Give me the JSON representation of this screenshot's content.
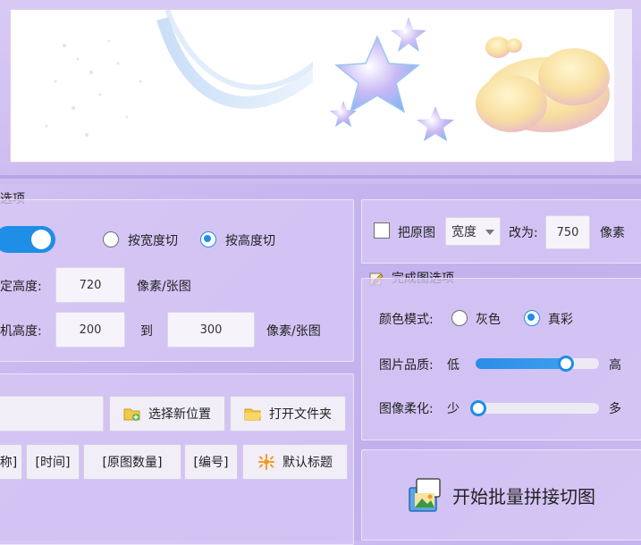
{
  "cut_options": {
    "section_title": "选项",
    "mode_width_label": "按宽度切",
    "mode_height_label": "按高度切",
    "fixed_height_label": "定高度:",
    "fixed_height_value": "720",
    "fixed_height_unit": "像素/张图",
    "random_height_label": "机高度:",
    "random_min_value": "200",
    "random_to_label": "到",
    "random_max_value": "300",
    "random_height_unit": "像素/张图"
  },
  "output": {
    "select_location_label": "选择新位置",
    "open_folder_label": "打开文件夹",
    "tags": [
      "称]",
      "[时间]",
      "[原图数量]",
      "[编号]"
    ],
    "default_title_label": "默认标题"
  },
  "resize": {
    "checkbox_label": "把原图",
    "dimension_value": "宽度",
    "change_to_label": "改为:",
    "value": "750",
    "unit": "像素"
  },
  "finished": {
    "section_title": "完成图选项",
    "color_mode_label": "颜色模式:",
    "gray_label": "灰色",
    "truecolor_label": "真彩",
    "quality_label": "图片品质:",
    "quality_low": "低",
    "quality_high": "高",
    "quality_level_percent": 73,
    "soften_label": "图像柔化:",
    "soften_low": "少",
    "soften_high": "多",
    "soften_level_percent": 0
  },
  "start_button_label": "开始批量拼接切图",
  "colors": {
    "accent": "#1e8ee6",
    "panel": "#d7c8f5"
  }
}
